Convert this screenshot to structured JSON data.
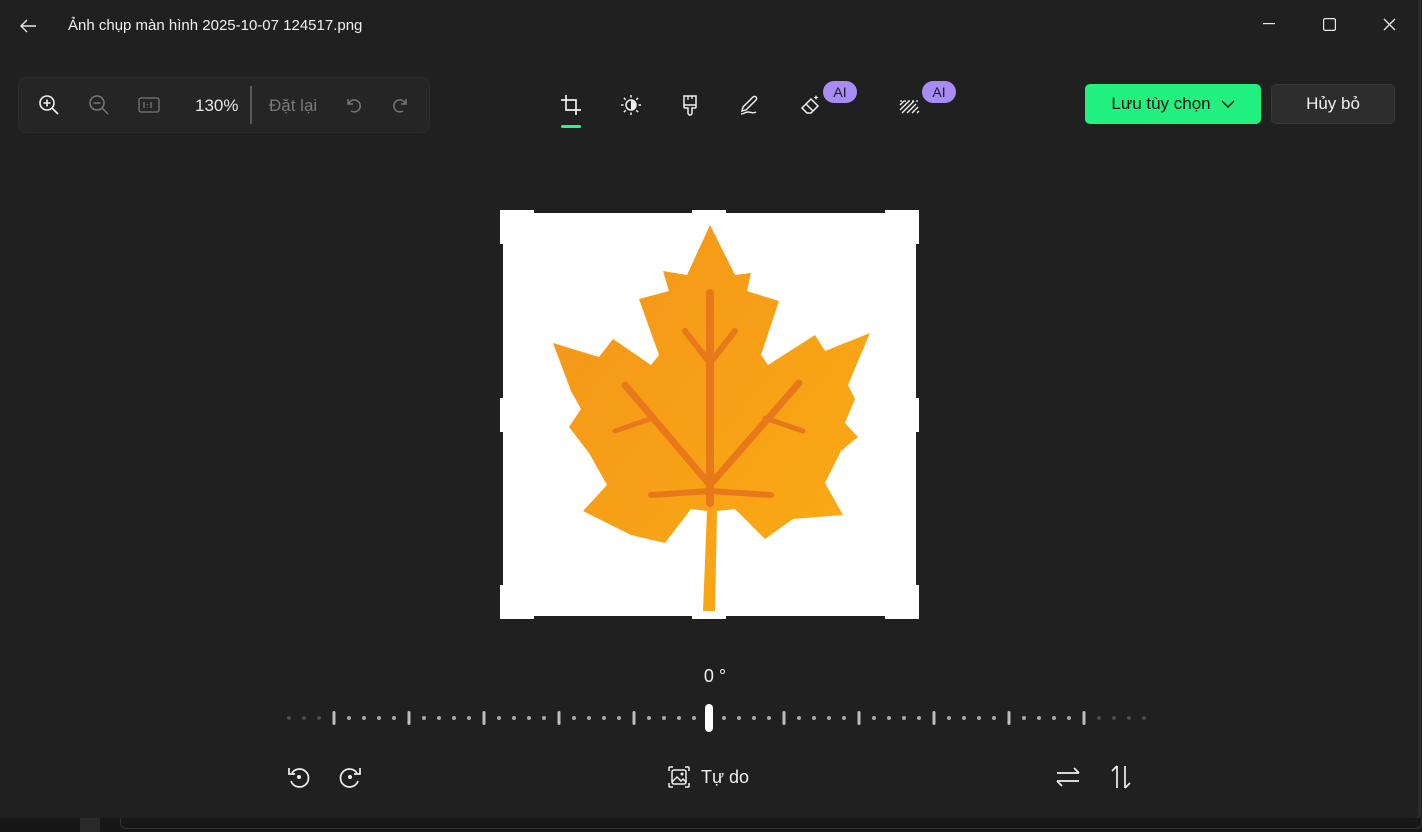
{
  "window": {
    "title": "Ảnh chụp màn hình 2025-10-07 124517.png"
  },
  "icons": {
    "back": "arrow-left-icon",
    "minimize": "minimize-icon",
    "maximize": "maximize-icon",
    "close": "close-icon",
    "zoom_in": "zoom-in-icon",
    "zoom_out": "zoom-out-icon",
    "actual_size": "actual-size-icon",
    "undo": "undo-icon",
    "redo": "redo-icon",
    "crop": "crop-icon",
    "adjust": "brightness-icon",
    "filter": "paint-brush-icon",
    "markup": "pen-icon",
    "erase": "eraser-icon",
    "background": "background-blur-icon",
    "rotate_left": "rotate-left-icon",
    "rotate_right": "rotate-right-icon",
    "aspect": "aspect-ratio-icon",
    "flip_h": "flip-horizontal-icon",
    "flip_v": "flip-vertical-icon",
    "chevron": "chevron-down-icon",
    "image": "maple-leaf-icon"
  },
  "zoom": {
    "level": "130%",
    "reset_label": "Đặt lại"
  },
  "tools": {
    "ai_badge": "AI",
    "active": "crop"
  },
  "actions": {
    "save_label": "Lưu tùy chọn",
    "cancel_label": "Hủy bỏ"
  },
  "straighten": {
    "angle_label": "0 °",
    "angle_value": 0
  },
  "crop": {
    "aspect_label": "Tự do"
  },
  "colors": {
    "accent": "#22f07f",
    "ai_badge": "#a98bf5",
    "background": "#202020",
    "leaf": "#f59a1c"
  }
}
